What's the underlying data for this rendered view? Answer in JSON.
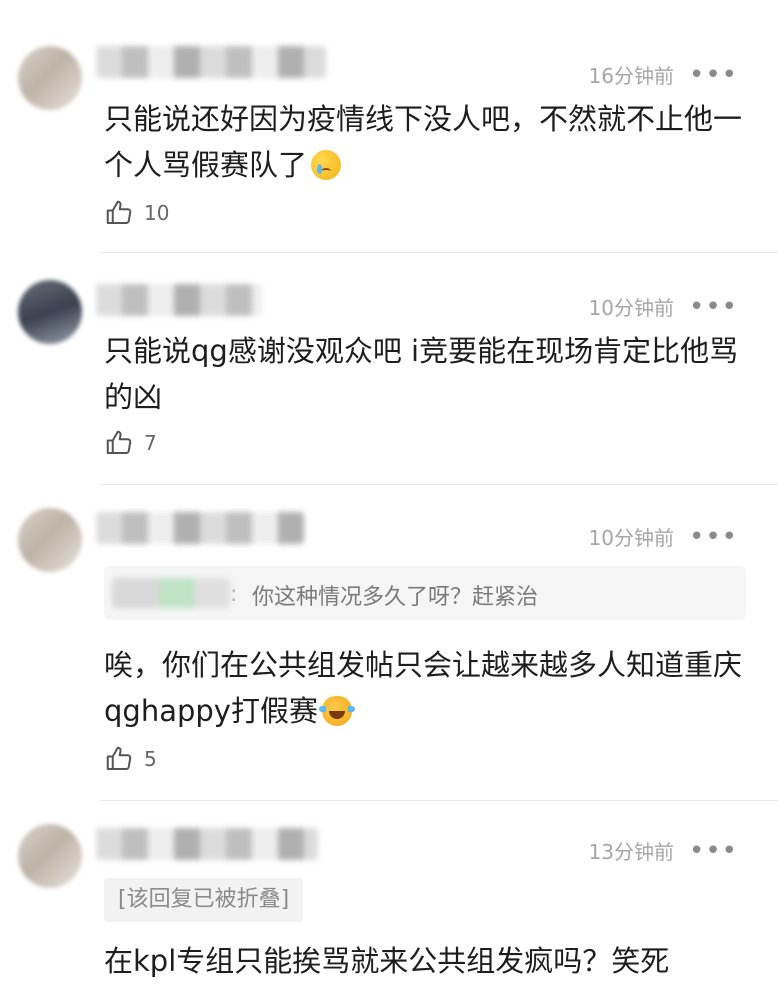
{
  "comments": [
    {
      "time": "16分钟前",
      "text": "只能说还好因为疫情线下没人吧，不然就不止他一个人骂假赛队了",
      "emoji": "crying-face-icon",
      "likes": "10"
    },
    {
      "time": "10分钟前",
      "text": "只能说qg感谢没观众吧 i竞要能在现场肯定比他骂的凶",
      "likes": "7"
    },
    {
      "time": "10分钟前",
      "reply_quote": "你这种情况多久了呀？赶紧治",
      "reply_separator": ":",
      "text": "唉，你们在公共组发帖只会让越来越多人知道重庆qghappy打假赛",
      "emoji": "tears-of-joy-cat-icon",
      "likes": "5"
    },
    {
      "time": "13分钟前",
      "folded_notice": "[该回复已被折叠]",
      "text": "在kpl专组只能挨骂就来公共组发疯吗？笑死"
    }
  ],
  "more_glyph": "•••",
  "colors": {
    "text": "#1e1e1e",
    "meta": "#a6a6a6",
    "reply_bg": "#f5f5f5"
  }
}
